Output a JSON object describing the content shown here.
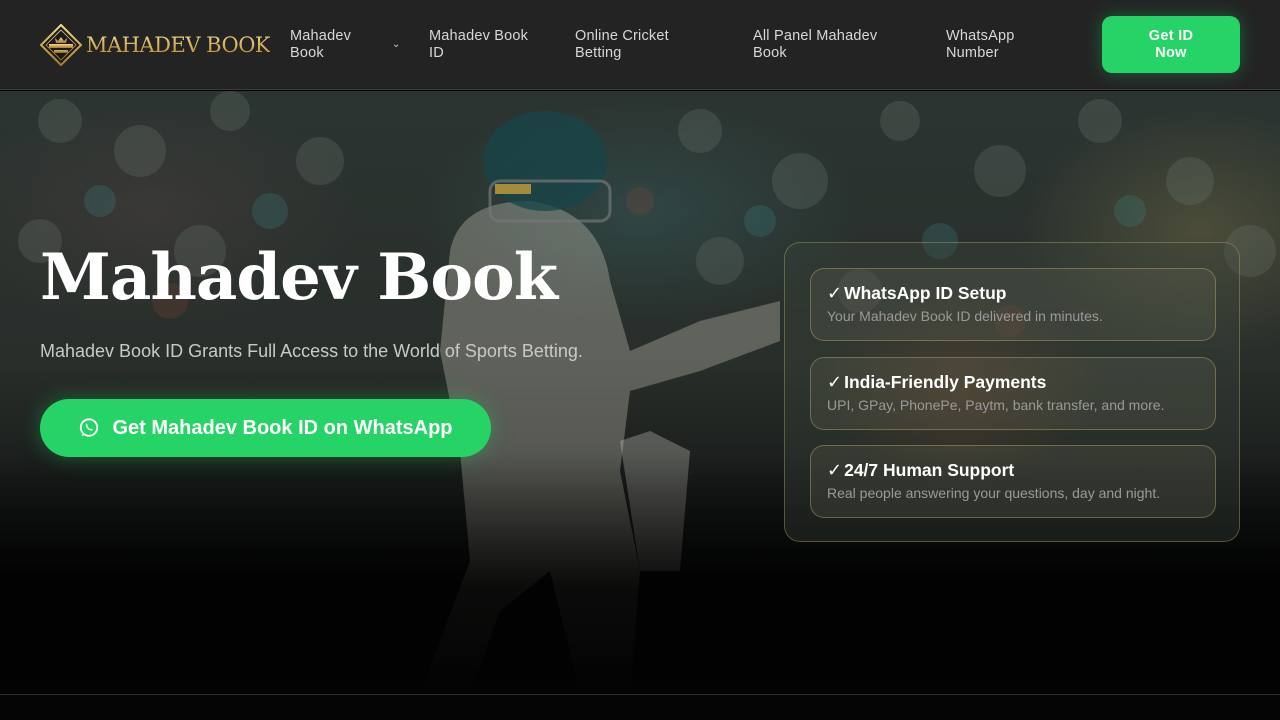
{
  "brand": {
    "name": "MAHADEV BOOK",
    "mark_text": "MAHADEV",
    "mark_sub": "BOOK"
  },
  "nav": {
    "items": [
      {
        "label": "Mahadev Book",
        "has_dropdown": true
      },
      {
        "label": "Mahadev Book ID"
      },
      {
        "label": "Online Cricket Betting"
      },
      {
        "label": "All Panel Mahadev Book"
      },
      {
        "label": "WhatsApp Number"
      }
    ],
    "cta_label": "Get ID Now"
  },
  "hero": {
    "title": "Mahadev Book",
    "subtitle": "Mahadev Book ID Grants Full Access to the World of Sports Betting.",
    "cta_label": "Get Mahadev Book ID on WhatsApp",
    "cta_icon": "whatsapp-icon"
  },
  "features": [
    {
      "check": "✓",
      "title": "WhatsApp ID Setup",
      "desc": "Your Mahadev Book ID delivered in minutes."
    },
    {
      "check": "✓",
      "title": "India-Friendly Payments",
      "desc": "UPI, GPay, PhonePe, Paytm, bank transfer, and more."
    },
    {
      "check": "✓",
      "title": "24/7 Human Support",
      "desc": "Real people answering your questions, day and night."
    }
  ],
  "colors": {
    "accent": "#25d366",
    "gold": "#c9a24a",
    "header_bg": "#232323"
  }
}
